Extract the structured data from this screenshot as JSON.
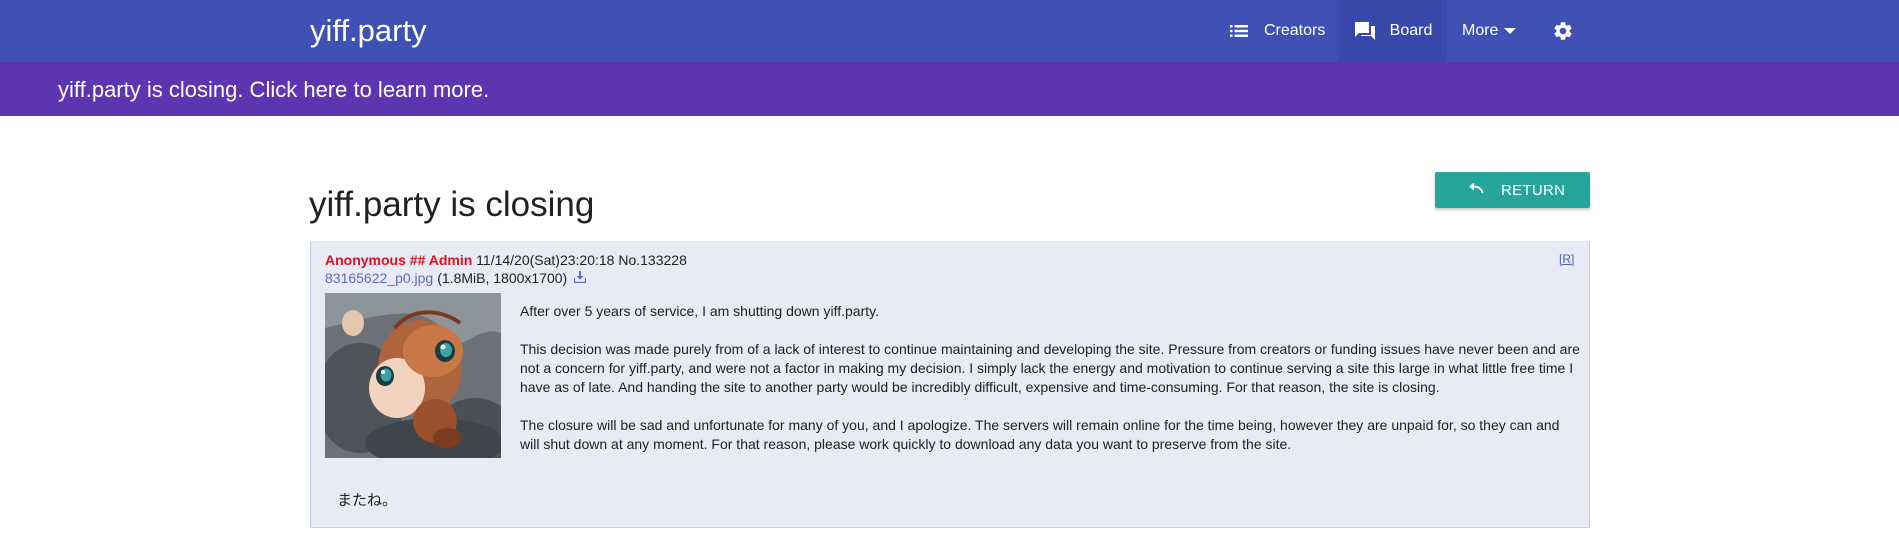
{
  "header": {
    "brand": "yiff.party",
    "nav": {
      "creators": "Creators",
      "board": "Board",
      "more": "More"
    },
    "icons": {
      "creators": "list-icon",
      "board": "forum-icon",
      "more": "caret-down-icon",
      "settings": "gear-icon"
    },
    "colors": {
      "topbar": "#3f51b5",
      "active_nav": "#3949ab",
      "banner": "#5e35b1"
    }
  },
  "banner": {
    "text": "yiff.party is closing. Click here to learn more."
  },
  "page": {
    "title": "yiff.party is closing",
    "return_label": "RETURN",
    "return_color": "#26a69a"
  },
  "post": {
    "name": "Anonymous ## Admin",
    "meta": "11/14/20(Sat)23:20:18 No.133228",
    "report": "[R]",
    "file_name": "83165622_p0.jpg",
    "file_info": "(1.8MiB, 1800x1700)",
    "paragraphs": [
      "After over 5 years of service, I am shutting down yiff.party.",
      "This decision was made purely from of a lack of interest to continue maintaining and developing the site. Pressure from creators or funding issues have never been and are not a concern for yiff.party, and were not a factor in making my decision. I simply lack the energy and motivation to continue serving a site this large in what little free time I have as of late. And handing the site to another party would be incredibly difficult, expensive and time-consuming. For that reason, the site is closing.",
      "The closure will be sad and unfortunate for many of you, and I apologize. The servers will remain online for the time being, however they are unpaid for, so they can and will shut down at any moment. For that reason, please work quickly to download any data you want to preserve from the site."
    ],
    "sign_off": "またね。",
    "name_color": "#e0101c",
    "background": "#e8eaf6"
  }
}
